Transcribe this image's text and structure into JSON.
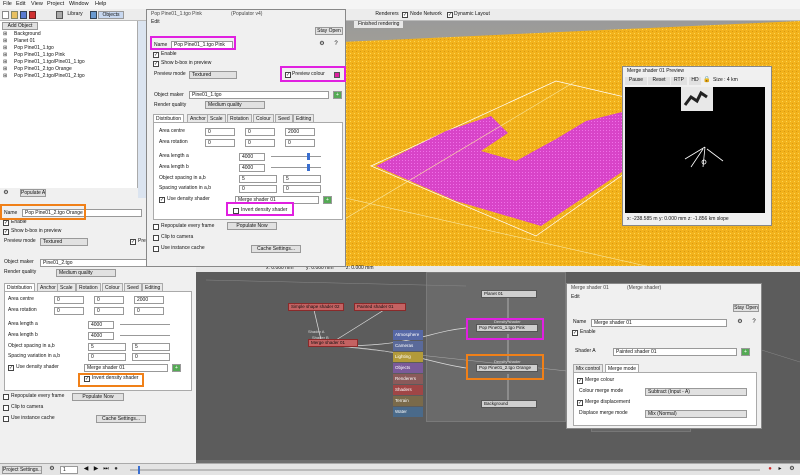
{
  "menu": [
    "File",
    "Edit",
    "View",
    "Project",
    "Window",
    "Help"
  ],
  "toolbar": {
    "library": "Library",
    "objects": "Objects",
    "renderers": "Renderers",
    "node_network": "Node Network",
    "dynamic_layout": "Dynamic Layout",
    "finished_rendering": "Finished rendering"
  },
  "objects_panel": {
    "add_object": "Add Object",
    "tree": [
      "Background",
      "Planet 01",
      "Pop Pine01_1.tgo",
      "Pop Pine01_1.tgo Pink",
      "Pop Pine01_1.tgo/Pine01_1.tgo",
      "Pop Pine01_2.tgo Orange",
      "Pop Pine01_2.tgo/Pine01_2.tgo"
    ],
    "populate_all": "Populate All"
  },
  "pink_window": {
    "title": "Pop Pine01_1.tgo Pink",
    "title_suffix": "(Populator v4)",
    "edit": "Edit",
    "stay_open": "Stay Open",
    "name_label": "Name",
    "name_value": "Pop Pine01_1.tgo Pink",
    "enable": "Enable",
    "show_bbox": "Show b-box in preview",
    "preview_mode_label": "Preview mode",
    "preview_mode_value": "Textured",
    "preview_colour": "Preview colour",
    "object_maker_label": "Object maker",
    "object_maker_value": "Pine01_1.tgo",
    "render_quality_label": "Render quality",
    "render_quality_value": "Medium quality",
    "tabs": [
      "Distribution",
      "Anchor",
      "Scale",
      "Rotation",
      "Colour",
      "Seed",
      "Editing"
    ],
    "area_centre_label": "Area centre",
    "area_centre": [
      "0",
      "0",
      "2000"
    ],
    "area_rotation_label": "Area rotation",
    "area_rotation": [
      "0",
      "0",
      "0"
    ],
    "area_length_a_label": "Area length a",
    "area_length_a": "4000",
    "area_length_b_label": "Area length b",
    "area_length_b": "4000",
    "spacing_label": "Object spacing in a,b",
    "spacing": [
      "5",
      "5"
    ],
    "variation_label": "Spacing variation in a,b",
    "variation": [
      "0",
      "0"
    ],
    "use_density_shader": "Use density shader",
    "density_shader_value": "Merge shader 01",
    "invert_density_shader": "Invert density shader",
    "repopulate": "Repopulate every frame",
    "populate_now": "Populate Now",
    "clip_to_camera": "Clip to camera",
    "use_instance_cache": "Use instance cache",
    "cache_settings": "Cache Settings..."
  },
  "orange_panel": {
    "name_label": "Name",
    "name_value": "Pop Pine01_2.tgo Orange",
    "enable": "Enable",
    "show_bbox": "Show b-box in preview",
    "preview_mode_label": "Preview mode",
    "preview_mode_value": "Textured",
    "preview_colour": "Pre",
    "object_maker_label": "Object maker",
    "object_maker_value": "Pine01_2.tgo",
    "render_quality_label": "Render quality",
    "render_quality_value": "Medium quality",
    "tabs": [
      "Distribution",
      "Anchor",
      "Scale",
      "Rotation",
      "Colour",
      "Seed",
      "Editing"
    ],
    "area_centre_label": "Area centre",
    "area_centre": [
      "0",
      "0",
      "2000"
    ],
    "area_rotation_label": "Area rotation",
    "area_rotation": [
      "0",
      "0",
      "0"
    ],
    "area_length_a_label": "Area length a",
    "area_length_a": "4000",
    "area_length_b_label": "Area length b",
    "area_length_b": "4000",
    "spacing_label": "Object spacing in a,b",
    "spacing": [
      "5",
      "5"
    ],
    "variation_label": "Spacing variation in a,b",
    "variation": [
      "0",
      "0"
    ],
    "use_density_shader": "Use density shader",
    "density_shader_value": "Merge shader 01",
    "invert_density_shader": "Invert density shader",
    "repopulate": "Repopulate every frame",
    "populate_now": "Populate Now",
    "clip_to_camera": "Clip to camera",
    "use_instance_cache": "Use instance cache",
    "cache_settings": "Cache Settings..."
  },
  "preview_window": {
    "title": "Merge shader 01 Preview",
    "pause": "Pause",
    "reset": "Reset",
    "rtp": "RTP",
    "hd": "HD",
    "size": "Size : 4 km",
    "coords": "x: -238.585 m   y: 0.000 mm   z: -1.856 km   slope"
  },
  "viewport_status": {
    "x": "x: 0.000 mm",
    "y": "y: 0.000 mm",
    "z": "z: 0.000 mm"
  },
  "node_network": {
    "categories": [
      "Atmosphere",
      "Cameras",
      "Lighting",
      "Objects",
      "Renderers",
      "Shaders",
      "Terrain",
      "Water"
    ],
    "nodes": {
      "simple_shape": "Simple shape shader 02",
      "painted": "Painted shader 01",
      "merge": "Merge shader 01",
      "planet": "Planet 01",
      "pop_pink": "Pop Pine01_1.tgo Pink",
      "pop_orange": "Pop Pine01_2.tgo Orange",
      "background": "Background",
      "shader_a": "Shader A",
      "shader_b": "Shader B",
      "density_shader": "Density shader"
    }
  },
  "merge_window": {
    "title": "Merge shader 01",
    "title_suffix": "(Merge shader)",
    "edit": "Edit",
    "stay_open": "Stay Open",
    "name_label": "Name",
    "name_value": "Merge shader 01",
    "enable": "Enable",
    "shader_a_label": "Shader A",
    "shader_a_value": "Painted shader 01",
    "tabs": [
      "Mix control",
      "Merge mode"
    ],
    "merge_colour": "Merge colour",
    "colour_merge_mode_label": "Colour merge mode",
    "colour_merge_mode_value": "Subtract (Input - A)",
    "merge_displacement": "Merge displacement",
    "displace_merge_mode_label": "Displace merge mode",
    "displace_merge_mode_value": "Mix (Normal)"
  },
  "bottom_bar": {
    "project_settings": "Project Settings...",
    "frame": "1"
  },
  "colors": {
    "pink_highlight": "#e020e0",
    "orange_highlight": "#f08018",
    "terrain_yellow": "#f2b21c",
    "pink_population": "#d844c8",
    "node_red": "#c46262"
  }
}
